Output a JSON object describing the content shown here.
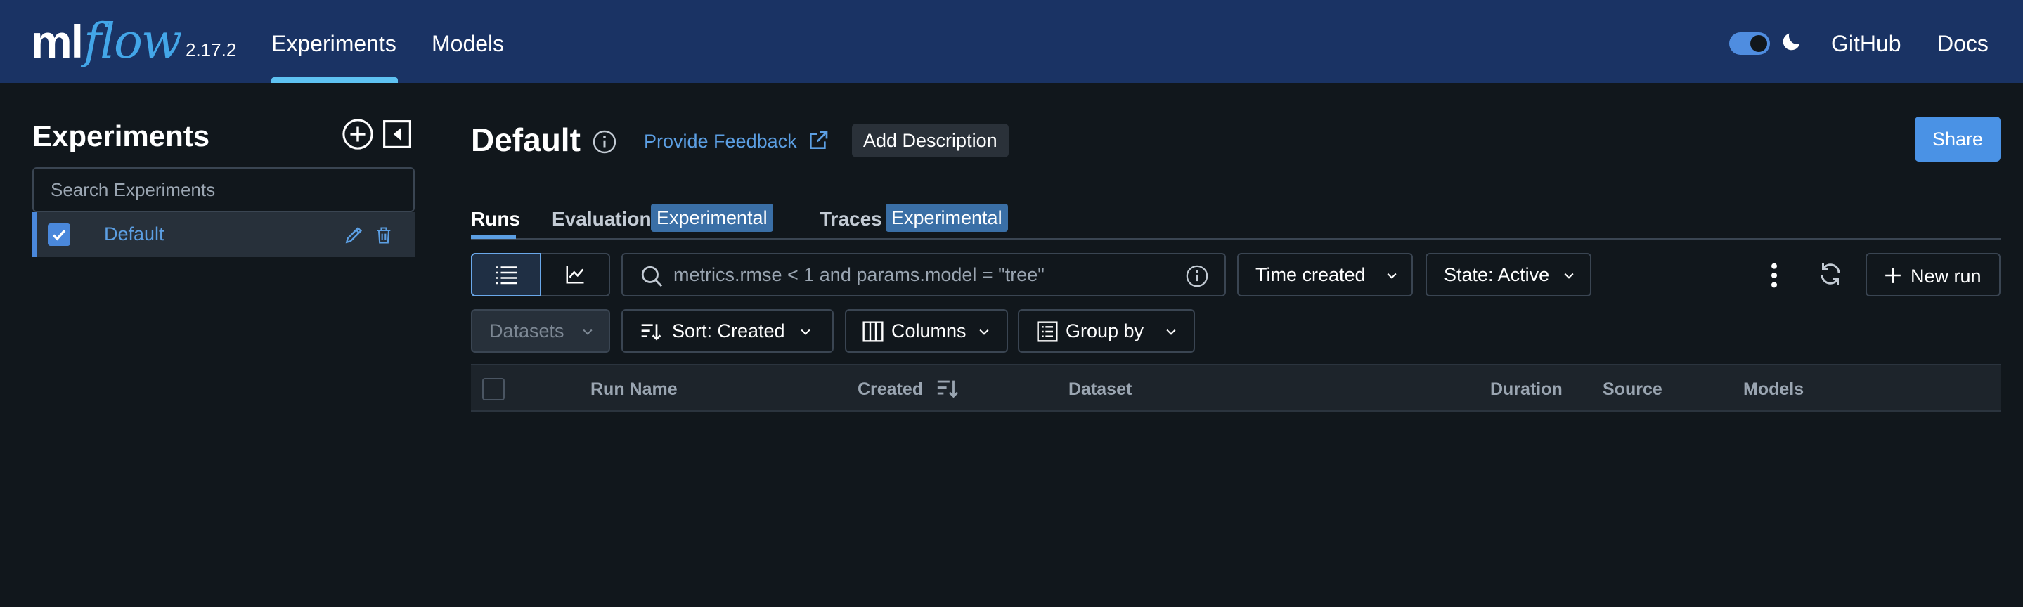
{
  "app": {
    "logo_ml": "ml",
    "logo_flow": "flow",
    "version": "2.17.2"
  },
  "nav": {
    "experiments": "Experiments",
    "models": "Models",
    "github": "GitHub",
    "docs": "Docs",
    "dark_mode_enabled": true
  },
  "sidebar": {
    "title": "Experiments",
    "search_placeholder": "Search Experiments",
    "items": [
      {
        "label": "Default",
        "checked": true
      }
    ]
  },
  "header": {
    "title": "Default",
    "feedback": "Provide Feedback",
    "add_description": "Add Description",
    "share": "Share"
  },
  "tabs": {
    "runs": "Runs",
    "evaluation": "Evaluation",
    "evaluation_badge": "Experimental",
    "traces": "Traces",
    "traces_badge": "Experimental"
  },
  "toolbar": {
    "filter_placeholder": "metrics.rmse < 1 and params.model = \"tree\"",
    "time_created": "Time created",
    "state": "State: Active",
    "new_run": "New run",
    "datasets": "Datasets",
    "sort": "Sort: Created",
    "columns": "Columns",
    "group_by": "Group by"
  },
  "table": {
    "columns": [
      "Run Name",
      "Created",
      "Dataset",
      "Duration",
      "Source",
      "Models"
    ]
  },
  "colors": {
    "topbar": "#1a3364",
    "background": "#11171c",
    "accent": "#4a92e5",
    "link": "#5c9fe3",
    "badge": "#3a6fa6"
  }
}
